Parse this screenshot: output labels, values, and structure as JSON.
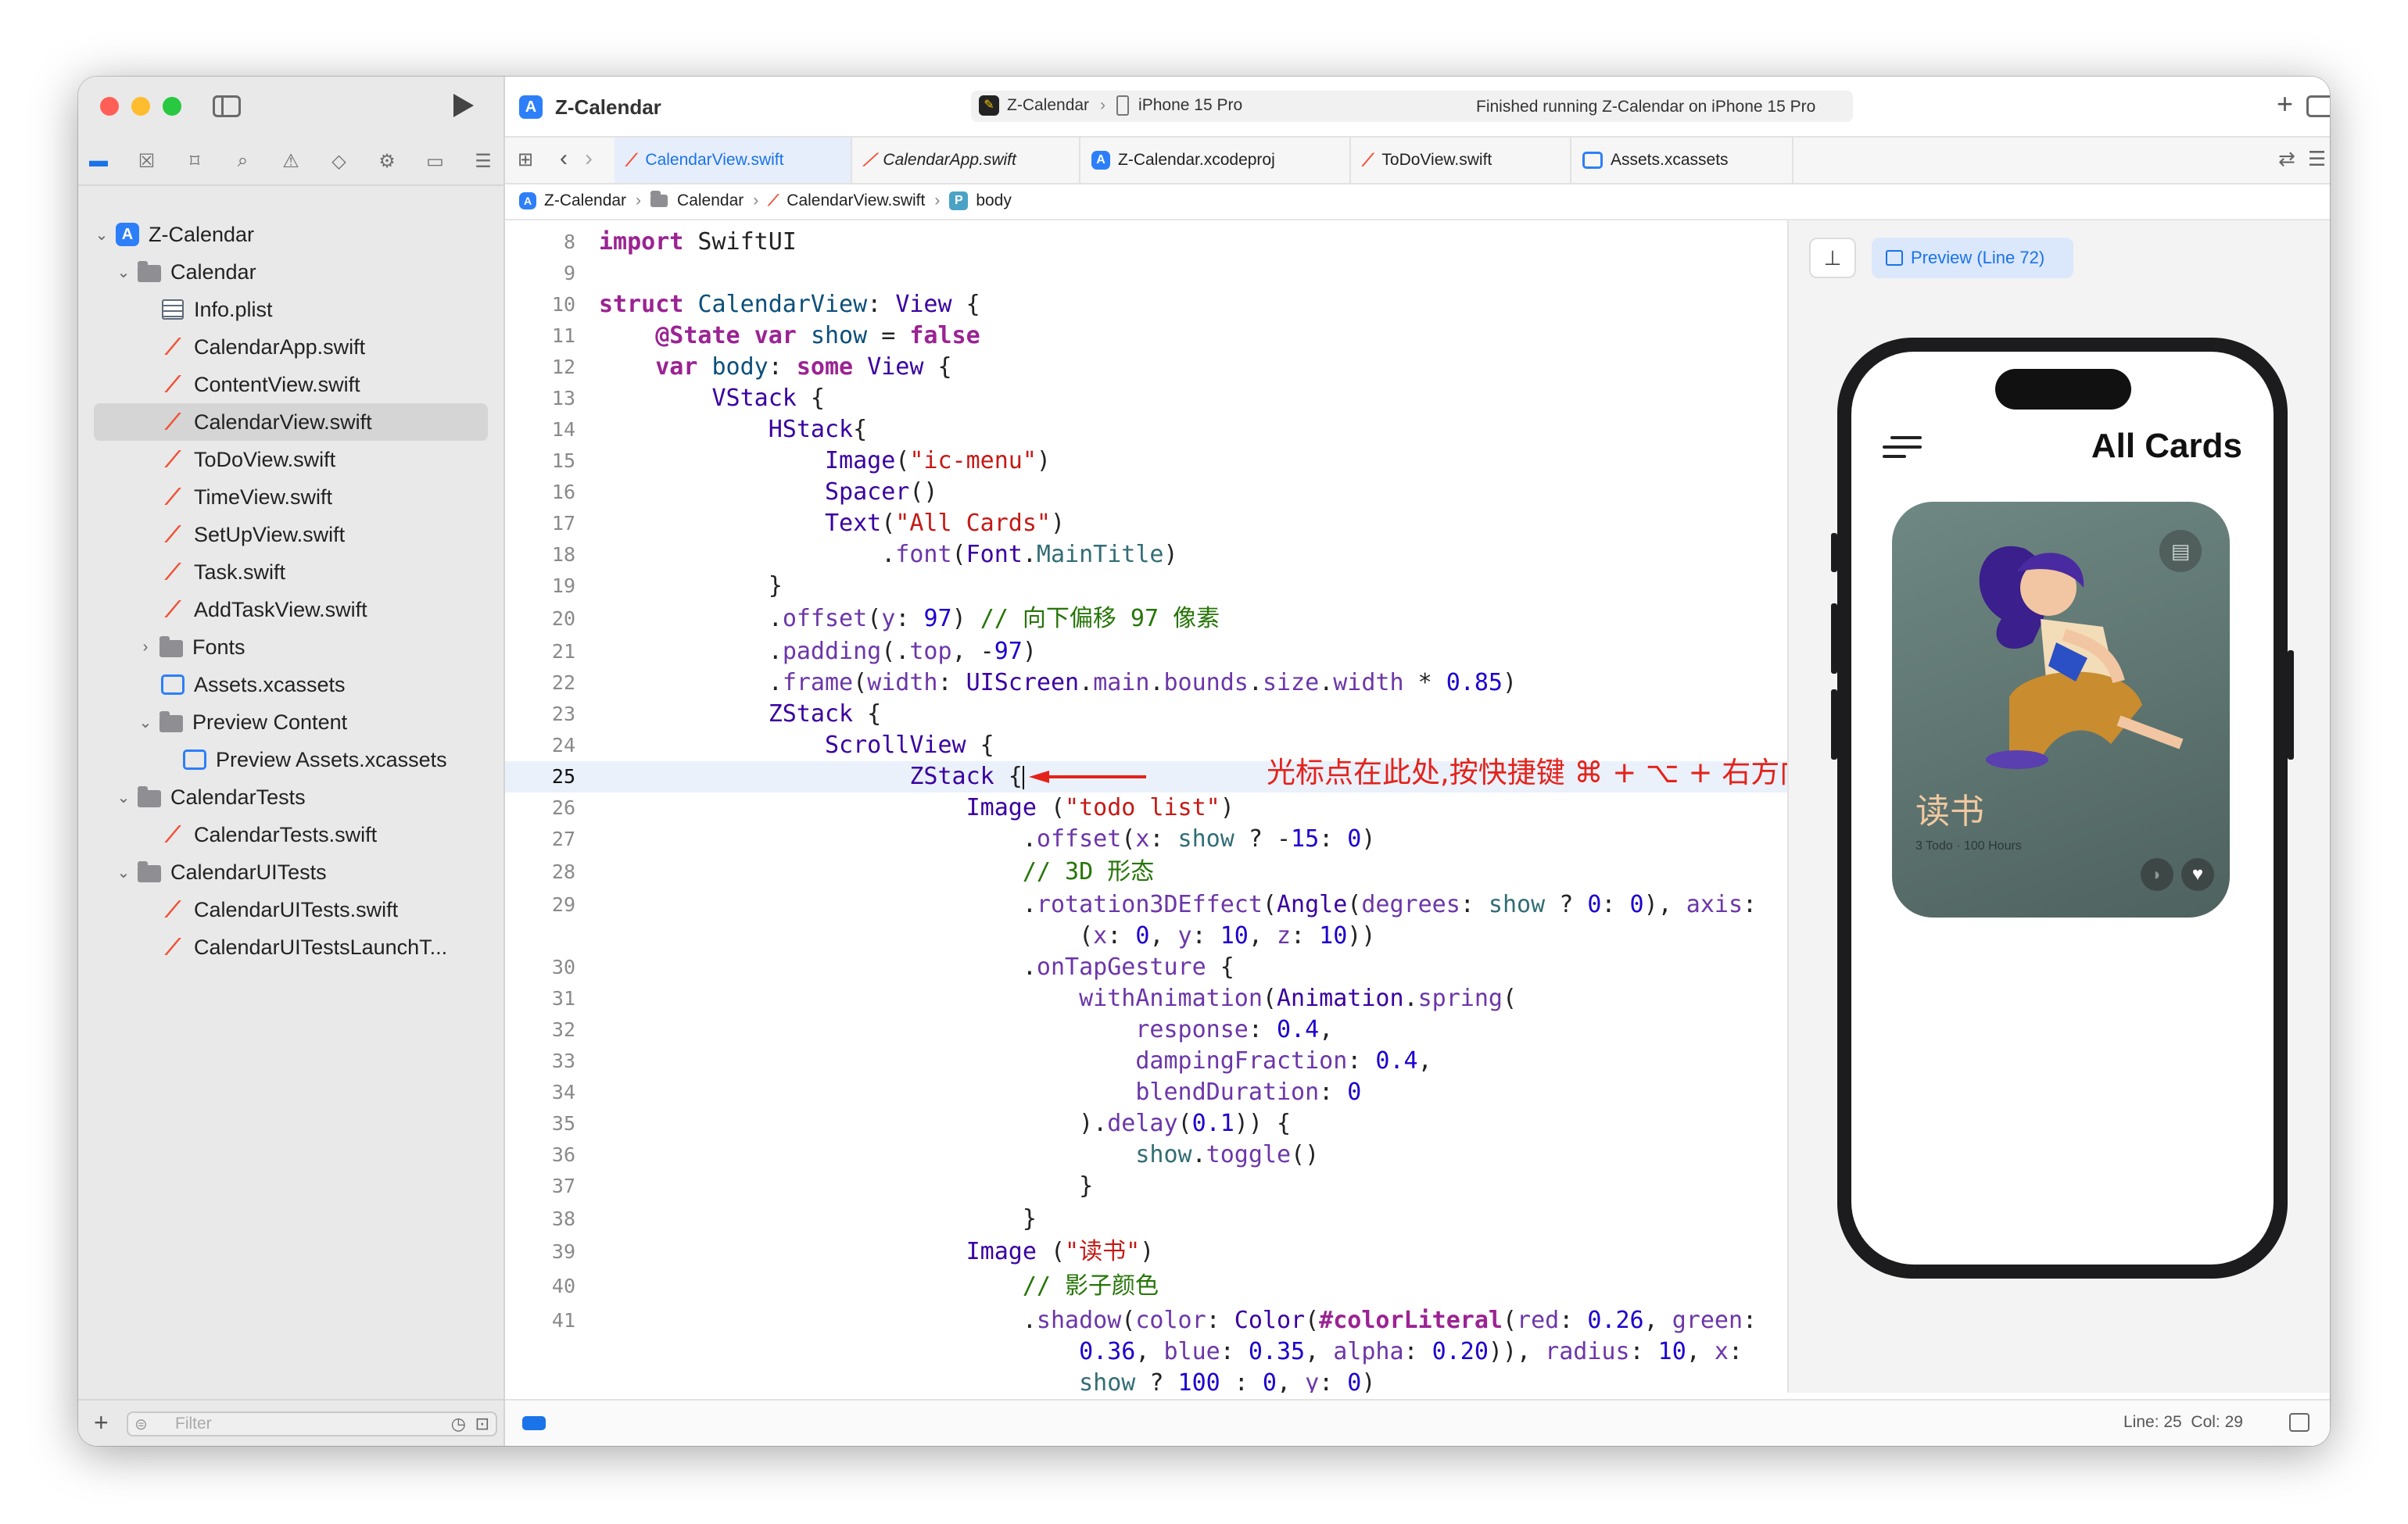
{
  "sidebar": {
    "project": "Z-Calendar",
    "filter_placeholder": "Filter",
    "items": [
      {
        "label": "Z-Calendar",
        "icon": "app-icon",
        "chevron": "⌄"
      },
      {
        "label": "Calendar",
        "icon": "folder-icon",
        "chevron": "⌄"
      },
      {
        "label": "Info.plist",
        "icon": "plist-icon",
        "chevron": ""
      },
      {
        "label": "CalendarApp.swift",
        "icon": "swift-icon",
        "chevron": ""
      },
      {
        "label": "ContentView.swift",
        "icon": "swift-icon",
        "chevron": ""
      },
      {
        "label": "CalendarView.swift",
        "icon": "swift-icon",
        "chevron": ""
      },
      {
        "label": "ToDoView.swift",
        "icon": "swift-icon",
        "chevron": ""
      },
      {
        "label": "TimeView.swift",
        "icon": "swift-icon",
        "chevron": ""
      },
      {
        "label": "SetUpView.swift",
        "icon": "swift-icon",
        "chevron": ""
      },
      {
        "label": "Task.swift",
        "icon": "swift-icon",
        "chevron": ""
      },
      {
        "label": "AddTaskView.swift",
        "icon": "swift-icon",
        "chevron": ""
      },
      {
        "label": "Fonts",
        "icon": "folder-icon",
        "chevron": "›"
      },
      {
        "label": "Assets.xcassets",
        "icon": "assets-icon",
        "chevron": ""
      },
      {
        "label": "Preview Content",
        "icon": "folder-icon",
        "chevron": "⌄"
      },
      {
        "label": "Preview Assets.xcassets",
        "icon": "assets-icon",
        "chevron": ""
      },
      {
        "label": "CalendarTests",
        "icon": "folder-icon",
        "chevron": "⌄"
      },
      {
        "label": "CalendarTests.swift",
        "icon": "swift-icon",
        "chevron": ""
      },
      {
        "label": "CalendarUITests",
        "icon": "folder-icon",
        "chevron": "⌄"
      },
      {
        "label": "CalendarUITests.swift",
        "icon": "swift-icon",
        "chevron": ""
      },
      {
        "label": "CalendarUITestsLaunchT...",
        "icon": "swift-icon",
        "chevron": ""
      }
    ]
  },
  "toolbar": {
    "project_title": "Z-Calendar",
    "scheme": "Z-Calendar",
    "device": "iPhone 15 Pro",
    "status": "Finished running Z-Calendar on iPhone 15 Pro",
    "add_label": "+"
  },
  "tabs": [
    {
      "label": "CalendarView.swift"
    },
    {
      "label": "CalendarApp.swift"
    },
    {
      "label": "Z-Calendar.xcodeproj"
    },
    {
      "label": "ToDoView.swift"
    },
    {
      "label": "Assets.xcassets"
    }
  ],
  "breadcrumb": [
    "Z-Calendar",
    "Calendar",
    "CalendarView.swift",
    "body"
  ],
  "breadcrumb_symbol": "P",
  "editor": {
    "current_line": 25,
    "annotation": "光标点在此处,按快捷键 ⌘ + ⌥ + 右方向键"
  },
  "preview": {
    "button_label": "Preview (Line 72)",
    "app_title": "All Cards",
    "card_title": "读书",
    "card_subtitle": "3 Todo · 100 Hours"
  },
  "status": {
    "position": "Line: 25  Col: 29"
  },
  "colors": {
    "accent": "#1a73e8",
    "swift": "#f05138",
    "annotation": "#e3231b"
  }
}
